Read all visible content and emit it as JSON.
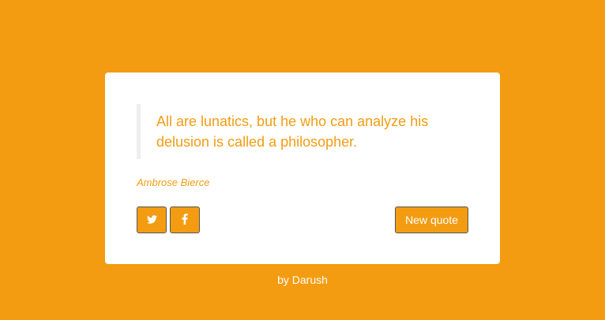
{
  "theme": {
    "accent": "#F39C12",
    "card_bg": "#FFFFFF",
    "text_on_accent": "#FFFFFF"
  },
  "quote": {
    "text": "All are lunatics, but he who can analyze his delusion is called a philosopher.",
    "author": "Ambrose Bierce"
  },
  "actions": {
    "twitter_icon": "twitter-icon",
    "facebook_icon": "facebook-icon",
    "new_quote_label": "New quote"
  },
  "footer": {
    "credit": "by Darush"
  }
}
